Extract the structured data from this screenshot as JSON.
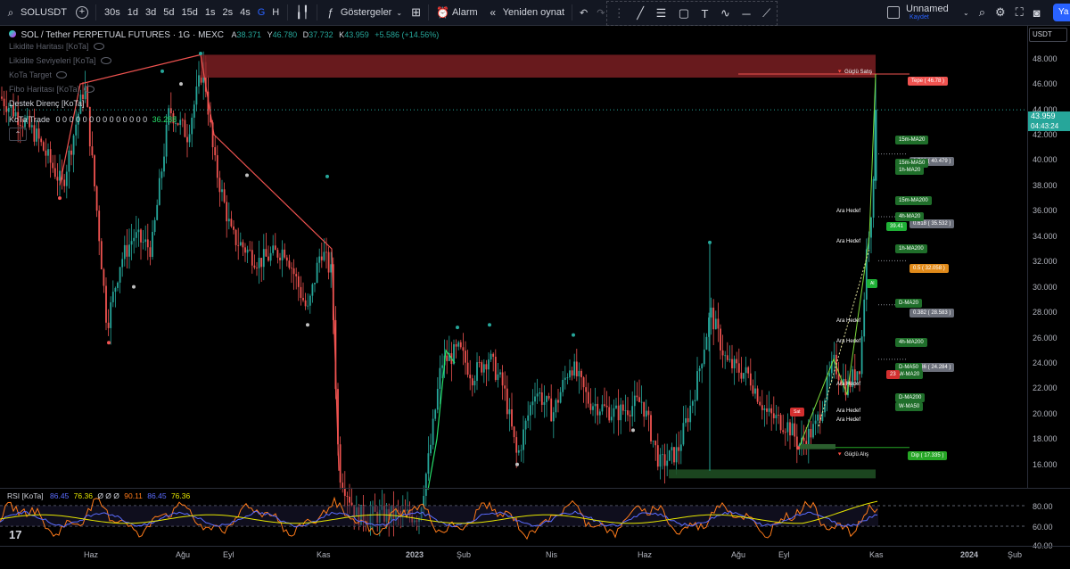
{
  "toolbar": {
    "symbol": "SOLUSDT",
    "timeframes": [
      "30s",
      "1d",
      "3d",
      "5d",
      "15d",
      "1s",
      "2s",
      "4s",
      "G",
      "H"
    ],
    "active_timeframe": "G",
    "indicators_label": "Göstergeler",
    "alarm_label": "Alarm",
    "replay_label": "Yeniden oynat",
    "layout_name": "Unnamed",
    "layout_saved": "Kaydet",
    "publish_label": "Ya"
  },
  "chart_header": {
    "title": "SOL / Tether PERPETUAL FUTURES · 1G · MEXC",
    "open_label": "A",
    "open": "38.371",
    "high_label": "Y",
    "high": "46.780",
    "low_label": "D",
    "low": "37.732",
    "close_label": "K",
    "close": "43.959",
    "change": "+5.586 (+14.56%)"
  },
  "indicators": [
    {
      "name": "Likidite Haritası [KoTa]",
      "hidden": true
    },
    {
      "name": "Likidite Seviyeleri [KoTa]",
      "hidden": true
    },
    {
      "name": "KoTa Target",
      "hidden": true
    },
    {
      "name": "Fibo Haritası [KoTa]",
      "hidden": true
    },
    {
      "name": "Destek Direnç [KoTa]",
      "hidden": false
    }
  ],
  "kota_trade": {
    "name": "KoTa Trade",
    "zeros": "0 0 0 0 0 0 0 0 0 0 0 0 0 0",
    "value": "36.288"
  },
  "price_axis": {
    "currency": "USDT",
    "ticks": [
      "48.000",
      "46.000",
      "44.000",
      "42.000",
      "40.000",
      "38.000",
      "36.000",
      "34.000",
      "32.000",
      "30.000",
      "28.000",
      "26.000",
      "24.000",
      "22.000",
      "20.000",
      "18.000",
      "16.000"
    ],
    "current_price": "43.959",
    "countdown": "04:43:24"
  },
  "annotations": {
    "strong_sell": "Güçlü Satış",
    "strong_buy": "Güçlü Alış",
    "top": "Tepe ( 46.78 )",
    "bottom": "Dip ( 17.335 )",
    "fib_786": "0.786 ( 40.479 )",
    "fib_618": "0.618 ( 35.532 )",
    "fib_5": "0.5 ( 32.058 )",
    "fib_382": "0.382 ( 28.583 )",
    "fib_236": "0.236 ( 24.284 )",
    "ma_labels": [
      "15m-MA20",
      "15m-MA50",
      "1h-MA20",
      "15m-MA200",
      "4h-MA20",
      "1h-MA200",
      "D-MA20",
      "4h-MA200",
      "D-MA50",
      "W-MA20",
      "D-MA200",
      "W-MA50"
    ],
    "target": "Ara Hedef",
    "price_39": "39.41",
    "price_23": "23",
    "buy_tag": "Al",
    "sell_tag": "Sat"
  },
  "rsi": {
    "name": "RSI [KoTa]",
    "v1": "86.45",
    "v2": "76.36",
    "zeros": "Ø Ø Ø",
    "v3": "90.11",
    "v4": "86.45",
    "v5": "76.36",
    "ticks": [
      "80.00",
      "60.00",
      "40.00"
    ]
  },
  "time_axis": [
    "Haz",
    "Ağu",
    "Eyl",
    "Kas",
    "2023",
    "Şub",
    "Nis",
    "Haz",
    "Ağu",
    "Eyl",
    "Kas",
    "2024",
    "Şub"
  ],
  "colors": {
    "up": "#26a69a",
    "down": "#ef5350",
    "accent": "#2962ff",
    "rsi_blue": "#5b6cff",
    "rsi_yellow": "#e6e600",
    "rsi_orange": "#ff7b1a"
  }
}
